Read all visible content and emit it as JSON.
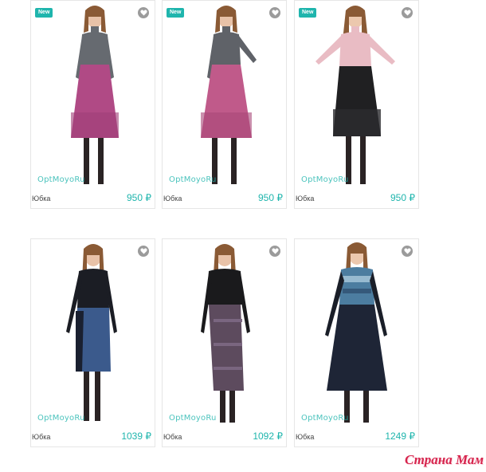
{
  "watermark": "Страна Мам",
  "brand_label": "OptMoyoRu",
  "products": [
    {
      "badge": "New",
      "name": "Юбка",
      "price": "950 ₽",
      "colors": {
        "top": "#666a70",
        "skirt": "#b04a85",
        "skin": "#e8c2a8"
      }
    },
    {
      "badge": "New",
      "name": "Юбка",
      "price": "950 ₽",
      "colors": {
        "top": "#5f6268",
        "skirt": "#c05a8a",
        "skin": "#e8c2a8"
      }
    },
    {
      "badge": "New",
      "name": "Юбка",
      "price": "950 ₽",
      "colors": {
        "top": "#e9bcc4",
        "skirt": "#202022",
        "skin": "#ecc8ae"
      }
    },
    {
      "badge": "",
      "name": "Юбка",
      "price": "1039 ₽",
      "colors": {
        "top": "#1b1d24",
        "skirt": "#3b5a8c",
        "skin": "#e8c2a8"
      }
    },
    {
      "badge": "",
      "name": "Юбка",
      "price": "1092 ₽",
      "colors": {
        "top": "#1a1a1c",
        "skirt": "#5d4b5e",
        "skin": "#e8c2a8"
      }
    },
    {
      "badge": "",
      "name": "Юбка",
      "price": "1249 ₽",
      "colors": {
        "top": "#4c7da0",
        "skirt": "#1e2536",
        "skin": "#ecc8ae"
      }
    }
  ]
}
